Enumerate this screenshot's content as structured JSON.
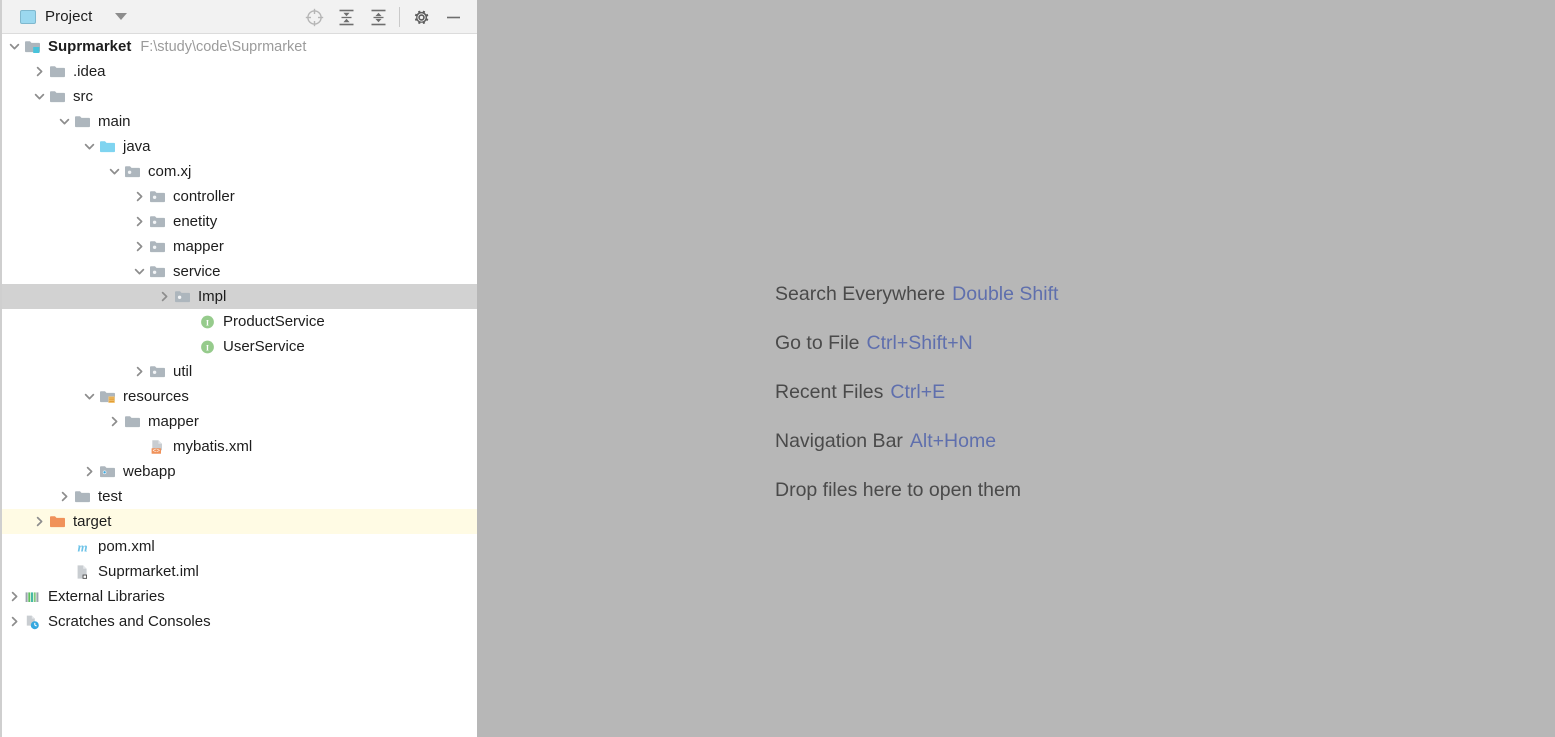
{
  "tool_window": {
    "title": "Project",
    "title_icon": "project-window-icon",
    "dropdown_icon": "chevron-down-icon",
    "actions": [
      {
        "name": "select-opened-file-icon",
        "label": "Select Opened File"
      },
      {
        "name": "expand-all-icon",
        "label": "Expand All"
      },
      {
        "name": "collapse-all-icon",
        "label": "Collapse All"
      },
      {
        "name": "settings-gear-icon",
        "label": "Settings"
      },
      {
        "name": "hide-icon",
        "label": "Hide"
      }
    ]
  },
  "tree": {
    "nodes": [
      {
        "label": "Suprmarket",
        "sub": "F:\\study\\code\\Suprmarket",
        "depth": 0,
        "arrow": "expanded",
        "icon": "project-root-folder-icon",
        "bold": true,
        "state": "normal"
      },
      {
        "label": ".idea",
        "sub": "",
        "depth": 1,
        "arrow": "collapsed",
        "icon": "folder-icon",
        "bold": false,
        "state": "normal"
      },
      {
        "label": "src",
        "sub": "",
        "depth": 1,
        "arrow": "expanded",
        "icon": "folder-icon",
        "bold": false,
        "state": "normal"
      },
      {
        "label": "main",
        "sub": "",
        "depth": 2,
        "arrow": "expanded",
        "icon": "folder-icon",
        "bold": false,
        "state": "normal"
      },
      {
        "label": "java",
        "sub": "",
        "depth": 3,
        "arrow": "expanded",
        "icon": "source-root-folder-icon",
        "bold": false,
        "state": "normal"
      },
      {
        "label": "com.xj",
        "sub": "",
        "depth": 4,
        "arrow": "expanded",
        "icon": "package-icon",
        "bold": false,
        "state": "normal"
      },
      {
        "label": "controller",
        "sub": "",
        "depth": 5,
        "arrow": "collapsed",
        "icon": "package-icon",
        "bold": false,
        "state": "normal"
      },
      {
        "label": "enetity",
        "sub": "",
        "depth": 5,
        "arrow": "collapsed",
        "icon": "package-icon",
        "bold": false,
        "state": "normal"
      },
      {
        "label": "mapper",
        "sub": "",
        "depth": 5,
        "arrow": "collapsed",
        "icon": "package-icon",
        "bold": false,
        "state": "normal"
      },
      {
        "label": "service",
        "sub": "",
        "depth": 5,
        "arrow": "expanded",
        "icon": "package-icon",
        "bold": false,
        "state": "normal"
      },
      {
        "label": "Impl",
        "sub": "",
        "depth": 6,
        "arrow": "collapsed",
        "icon": "package-icon",
        "bold": false,
        "state": "selected"
      },
      {
        "label": "ProductService",
        "sub": "",
        "depth": 7,
        "arrow": "none",
        "icon": "java-interface-icon",
        "bold": false,
        "state": "normal"
      },
      {
        "label": "UserService",
        "sub": "",
        "depth": 7,
        "arrow": "none",
        "icon": "java-interface-icon",
        "bold": false,
        "state": "normal"
      },
      {
        "label": "util",
        "sub": "",
        "depth": 5,
        "arrow": "collapsed",
        "icon": "package-icon",
        "bold": false,
        "state": "normal"
      },
      {
        "label": "resources",
        "sub": "",
        "depth": 3,
        "arrow": "expanded",
        "icon": "resources-root-folder-icon",
        "bold": false,
        "state": "normal"
      },
      {
        "label": "mapper",
        "sub": "",
        "depth": 4,
        "arrow": "collapsed",
        "icon": "folder-icon",
        "bold": false,
        "state": "normal"
      },
      {
        "label": "mybatis.xml",
        "sub": "",
        "depth": 5,
        "arrow": "none",
        "icon": "xml-file-icon",
        "bold": false,
        "state": "normal"
      },
      {
        "label": "webapp",
        "sub": "",
        "depth": 3,
        "arrow": "collapsed",
        "icon": "webapp-folder-icon",
        "bold": false,
        "state": "normal"
      },
      {
        "label": "test",
        "sub": "",
        "depth": 2,
        "arrow": "collapsed",
        "icon": "folder-icon",
        "bold": false,
        "state": "normal"
      },
      {
        "label": "target",
        "sub": "",
        "depth": 1,
        "arrow": "collapsed",
        "icon": "excluded-folder-icon",
        "bold": false,
        "state": "highlight"
      },
      {
        "label": "pom.xml",
        "sub": "",
        "depth": 2,
        "arrow": "none",
        "icon": "maven-file-icon",
        "bold": false,
        "state": "normal"
      },
      {
        "label": "Suprmarket.iml",
        "sub": "",
        "depth": 2,
        "arrow": "none",
        "icon": "iml-file-icon",
        "bold": false,
        "state": "normal"
      },
      {
        "label": "External Libraries",
        "sub": "",
        "depth": 0,
        "arrow": "collapsed",
        "icon": "external-libraries-icon",
        "bold": false,
        "state": "normal"
      },
      {
        "label": "Scratches and Consoles",
        "sub": "",
        "depth": 0,
        "arrow": "collapsed",
        "icon": "scratches-icon",
        "bold": false,
        "state": "normal"
      }
    ]
  },
  "editor": {
    "hints": [
      {
        "label": "Search Everywhere",
        "key": "Double Shift"
      },
      {
        "label": "Go to File",
        "key": "Ctrl+Shift+N"
      },
      {
        "label": "Recent Files",
        "key": "Ctrl+E"
      },
      {
        "label": "Navigation Bar",
        "key": "Alt+Home"
      },
      {
        "label": "Drop files here to open them",
        "key": ""
      }
    ]
  },
  "colors": {
    "editor_background": "#b7b7b7",
    "hint_key": "#5f6fad",
    "hint_label": "#4a4a4a",
    "selection": "#d2d2d2",
    "excluded_highlight": "#fffbe4",
    "folder": "#afb8bf",
    "source_root": "#79d0ee",
    "excluded_folder": "#f0925a",
    "interface_green": "#96cb8c"
  }
}
